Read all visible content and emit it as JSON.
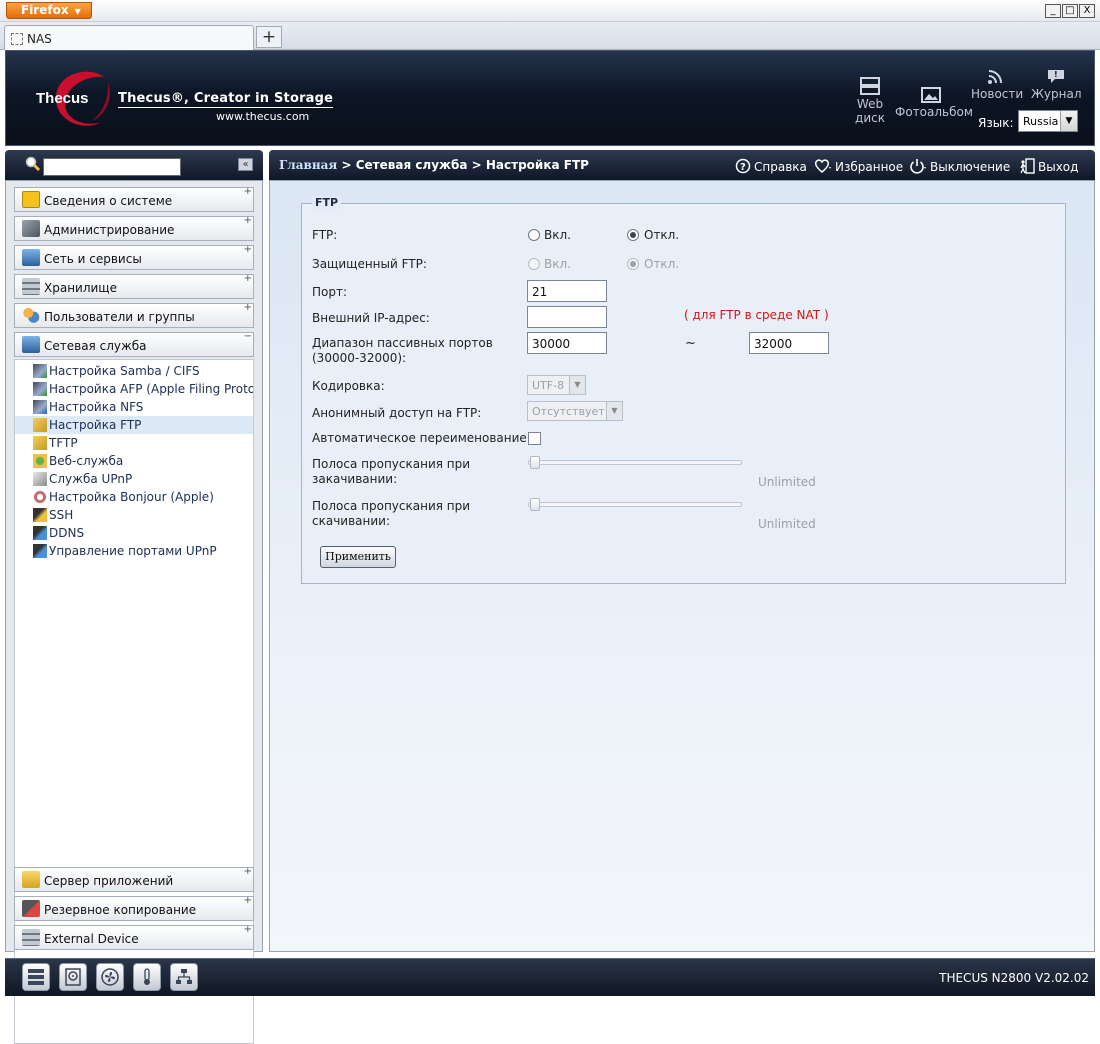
{
  "browser": {
    "app_button": "Firefox",
    "tab_title": "NAS",
    "new_tab": "+",
    "win_min": "_",
    "win_max": "□",
    "win_close": "X"
  },
  "header": {
    "logo_text": "Thecus",
    "tagline": "Thecus®, Creator in Storage",
    "website": "www.thecus.com",
    "links": {
      "webdisk_1": "Web",
      "webdisk_2": "диск",
      "photo": "Фотоальбом",
      "news": "Новости",
      "journal": "Журнал"
    },
    "language_label": "Язык:",
    "language_value": "Russia"
  },
  "breadcrumb": {
    "home": "Главная",
    "path": " > Сетевая служба > Настройка FTP"
  },
  "top_actions": {
    "help": "Справка",
    "favorites": "Избранное",
    "shutdown": "Выключение",
    "logout": "Выход"
  },
  "sidebar": {
    "collapse": "«",
    "sections": [
      "Сведения о системе",
      "Администрирование",
      "Сеть и сервисы",
      "Хранилище",
      "Пользователи и группы",
      "Сетевая служба"
    ],
    "expanded_items": [
      "Настройка Samba / CIFS",
      "Настройка AFP (Apple Filing Protocol)",
      "Настройка NFS",
      "Настройка FTP",
      "TFTP",
      "Веб-служба",
      "Служба UPnP",
      "Настройка Bonjour (Apple)",
      "SSH",
      "DDNS",
      "Управление портами UPnP"
    ],
    "bottom_sections": [
      "Сервер приложений",
      "Резервное копирование",
      "External Device"
    ],
    "plus": "+",
    "minus": "−"
  },
  "ftp_form": {
    "legend": "FTP",
    "ftp_label": "FTP:",
    "on": "Вкл.",
    "off": "Откл.",
    "secure_label": "Защищенный FTP:",
    "port_label": "Порт:",
    "port_value": "21",
    "external_ip_label": "Внешний IP-адрес:",
    "external_ip_value": "",
    "nat_note": "( для FTP в среде NAT )",
    "passive_label_1": "Диапазон пассивных портов",
    "passive_label_2": "(30000-32000):",
    "passive_from": "30000",
    "tilde": "~",
    "passive_to": "32000",
    "encoding_label": "Кодировка:",
    "encoding_value": "UTF-8",
    "anon_label": "Анонимный доступ на FTP:",
    "anon_value": "Отсутствует",
    "auto_rename_label": "Автоматическое переименование:",
    "upload_bw_label_1": "Полоса пропускания при",
    "upload_bw_label_2": "закачивании:",
    "upload_bw_value": "Unlimited",
    "download_bw_label_1": "Полоса пропускания при",
    "download_bw_label_2": "скачивании:",
    "download_bw_value": "Unlimited",
    "apply": "Применить",
    "ftp_enabled": false,
    "secure_enabled": false,
    "auto_rename_checked": false
  },
  "footer": {
    "version": "THECUS N2800 V2.02.02"
  },
  "colors": {
    "header_bg": "#0d1626",
    "accent_red": "#d31414",
    "panel_bg": "#dbe6f4",
    "firefox_orange": "#e36d0b"
  }
}
